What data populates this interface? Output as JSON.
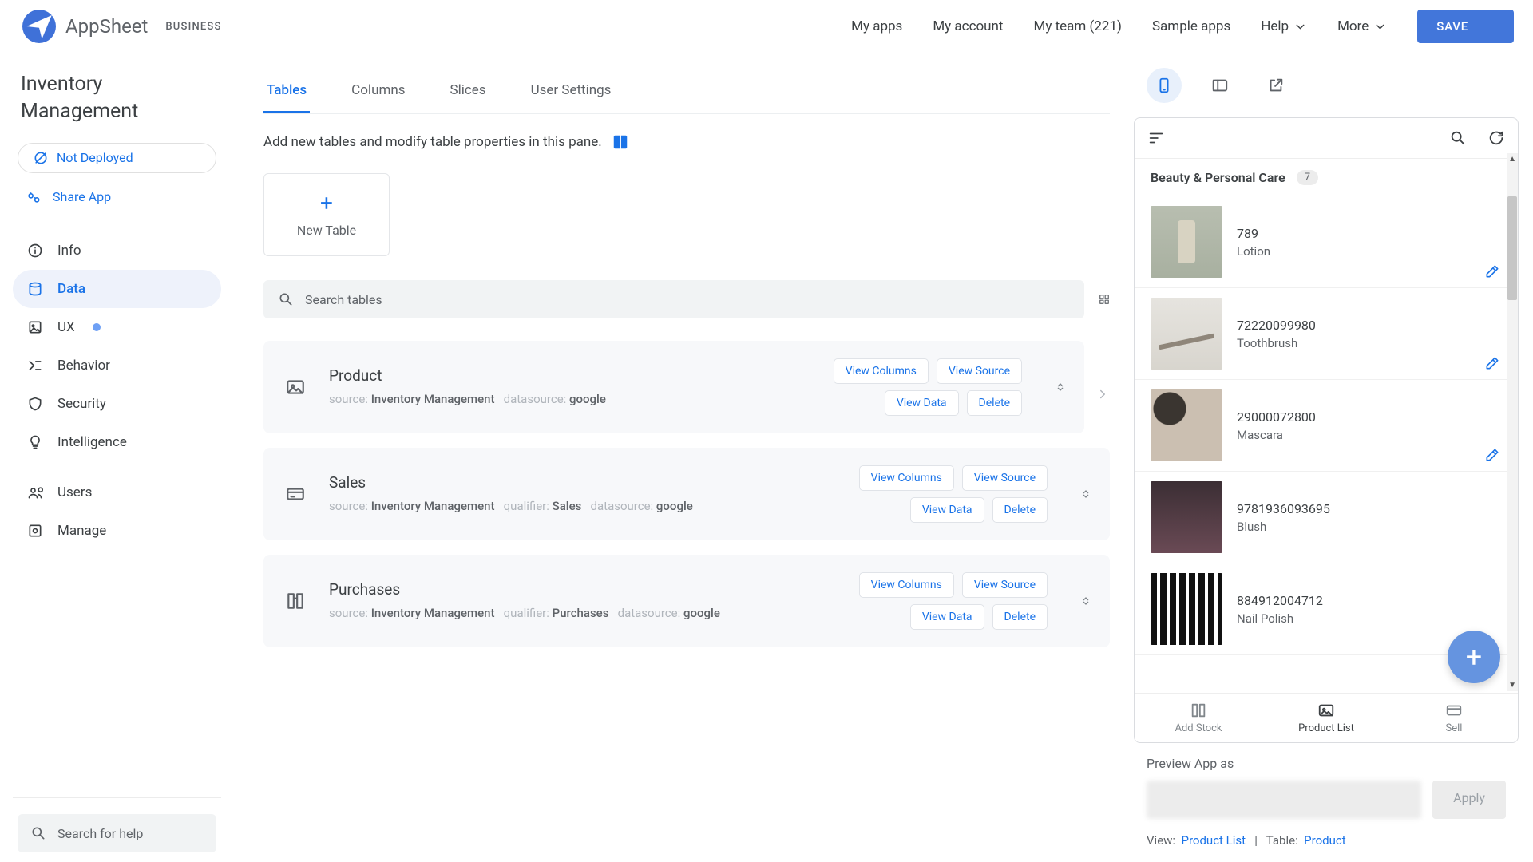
{
  "brand": {
    "name": "AppSheet",
    "plan": "BUSINESS"
  },
  "topnav": {
    "my_apps": "My apps",
    "my_account": "My account",
    "my_team": "My team (221)",
    "sample_apps": "Sample apps",
    "help": "Help",
    "more": "More",
    "save": "SAVE"
  },
  "sidebar": {
    "app_title": "Inventory Management",
    "not_deployed": "Not Deployed",
    "share_app": "Share App",
    "items": [
      {
        "label": "Info"
      },
      {
        "label": "Data"
      },
      {
        "label": "UX"
      },
      {
        "label": "Behavior"
      },
      {
        "label": "Security"
      },
      {
        "label": "Intelligence"
      }
    ],
    "users": "Users",
    "manage": "Manage",
    "search_help_placeholder": "Search for help"
  },
  "data_tabs": [
    "Tables",
    "Columns",
    "Slices",
    "User Settings"
  ],
  "hint_text": "Add new tables and modify table properties in this pane.",
  "new_table": "New Table",
  "search_tables_placeholder": "Search tables",
  "tables": [
    {
      "name": "Product",
      "source_label": "source:",
      "source": "Inventory Management",
      "datasource_label": "datasource:",
      "datasource": "google"
    },
    {
      "name": "Sales",
      "source_label": "source:",
      "source": "Inventory Management",
      "qualifier_label": "qualifier:",
      "qualifier": "Sales",
      "datasource_label": "datasource:",
      "datasource": "google"
    },
    {
      "name": "Purchases",
      "source_label": "source:",
      "source": "Inventory Management",
      "qualifier_label": "qualifier:",
      "qualifier": "Purchases",
      "datasource_label": "datasource:",
      "datasource": "google"
    }
  ],
  "table_actions": {
    "view_columns": "View Columns",
    "view_source": "View Source",
    "view_data": "View Data",
    "delete": "Delete"
  },
  "preview": {
    "category": "Beauty & Personal Care",
    "category_count": "7",
    "items": [
      {
        "code": "789",
        "name": "Lotion"
      },
      {
        "code": "72220099980",
        "name": "Toothbrush"
      },
      {
        "code": "29000072800",
        "name": "Mascara"
      },
      {
        "code": "9781936093695",
        "name": "Blush"
      },
      {
        "code": "884912004712",
        "name": "Nail Polish"
      }
    ],
    "nav": {
      "add_stock": "Add Stock",
      "product_list": "Product List",
      "sell": "Sell"
    },
    "footer": {
      "preview_as_label": "Preview App as",
      "apply": "Apply",
      "view_label": "View:",
      "view_value": "Product List",
      "table_label": "Table:",
      "table_value": "Product"
    }
  }
}
